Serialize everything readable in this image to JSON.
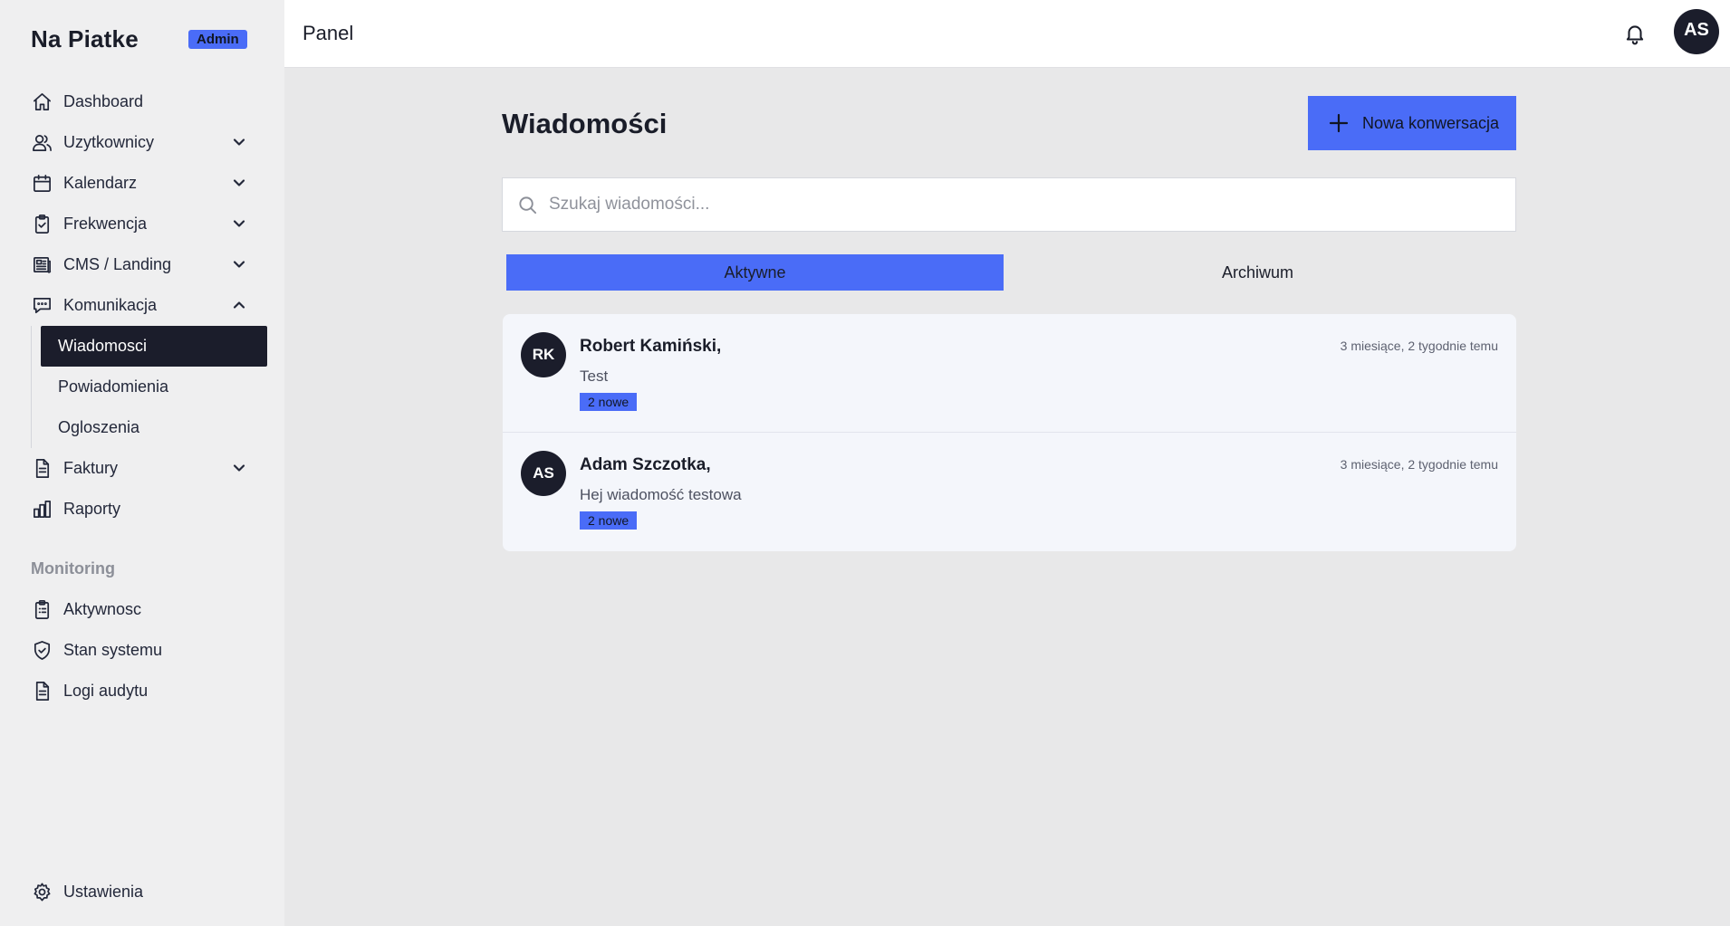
{
  "brand": {
    "name": "Na Piatke",
    "badge": "Admin"
  },
  "sidebar": {
    "items": [
      {
        "label": "Dashboard",
        "icon": "home-icon"
      },
      {
        "label": "Uzytkownicy",
        "icon": "users-icon",
        "expandable": true
      },
      {
        "label": "Kalendarz",
        "icon": "calendar-icon",
        "expandable": true
      },
      {
        "label": "Frekwencja",
        "icon": "clipboard-check-icon",
        "expandable": true
      },
      {
        "label": "CMS / Landing",
        "icon": "newspaper-icon",
        "expandable": true
      },
      {
        "label": "Komunikacja",
        "icon": "chat-icon",
        "expanded": true
      },
      {
        "label": "Faktury",
        "icon": "document-icon",
        "expandable": true
      },
      {
        "label": "Raporty",
        "icon": "bar-chart-icon"
      }
    ],
    "komunikacja_sub": [
      {
        "label": "Wiadomosci",
        "active": true
      },
      {
        "label": "Powiadomienia"
      },
      {
        "label": "Ogloszenia"
      }
    ],
    "monitoring_label": "Monitoring",
    "monitoring_items": [
      {
        "label": "Aktywnosc",
        "icon": "clipboard-list-icon"
      },
      {
        "label": "Stan systemu",
        "icon": "shield-check-icon"
      },
      {
        "label": "Logi audytu",
        "icon": "document-icon"
      }
    ],
    "settings_label": "Ustawienia"
  },
  "topbar": {
    "title": "Panel",
    "avatar_initials": "AS"
  },
  "main": {
    "title": "Wiadomości",
    "new_button": "Nowa konwersacja",
    "search_placeholder": "Szukaj wiadomości...",
    "tabs": [
      {
        "label": "Aktywne",
        "active": true
      },
      {
        "label": "Archiwum"
      }
    ],
    "conversations": [
      {
        "initials": "RK",
        "name": "Robert Kamiński,",
        "time": "3 miesiące, 2 tygodnie temu",
        "preview": "Test",
        "badge": "2 nowe"
      },
      {
        "initials": "AS",
        "name": "Adam Szczotka,",
        "time": "3 miesiące, 2 tygodnie temu",
        "preview": "Hej wiadomość testowa",
        "badge": "2 nowe"
      }
    ]
  },
  "colors": {
    "accent": "#4a6cf7",
    "dark": "#1b1d2b",
    "background": "#e8e8e9"
  }
}
